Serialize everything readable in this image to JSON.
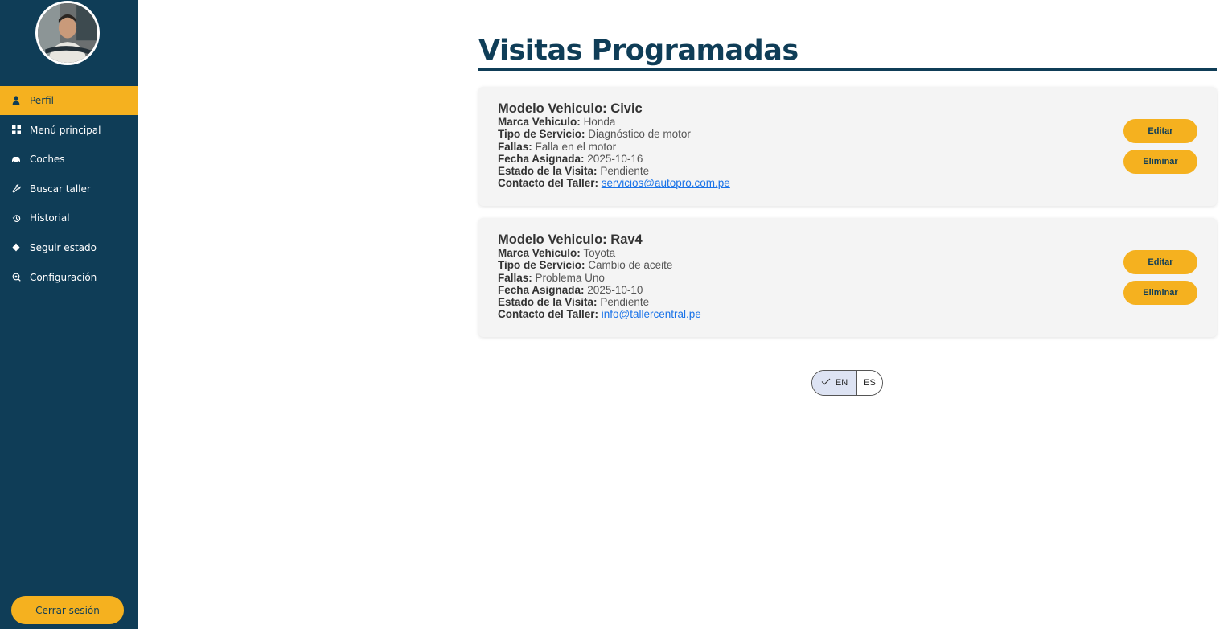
{
  "sidebar": {
    "items": [
      {
        "label": "Perfil",
        "icon": "user-icon",
        "active": true
      },
      {
        "label": "Menú principal",
        "icon": "grid-icon",
        "active": false
      },
      {
        "label": "Coches",
        "icon": "car-icon",
        "active": false
      },
      {
        "label": "Buscar taller",
        "icon": "wrench-icon",
        "active": false
      },
      {
        "label": "Historial",
        "icon": "history-icon",
        "active": false
      },
      {
        "label": "Seguir estado",
        "icon": "diamond-icon",
        "active": false
      },
      {
        "label": "Configuración",
        "icon": "settings-icon",
        "active": false
      }
    ],
    "logout_label": "Cerrar sesión"
  },
  "main": {
    "title": "Visitas Programadas",
    "labels": {
      "modelo": "Modelo Vehiculo:",
      "marca": "Marca Vehiculo:",
      "servicio": "Tipo de Servicio:",
      "fallas": "Fallas:",
      "fecha": "Fecha Asignada:",
      "estado": "Estado de la Visita:",
      "contacto": "Contacto del Taller:"
    },
    "visits": [
      {
        "modelo": "Civic",
        "marca": "Honda",
        "servicio": "Diagnóstico de motor",
        "fallas": "Falla en el motor",
        "fecha": "2025-10-16",
        "estado": "Pendiente",
        "contacto": "servicios@autopro.com.pe",
        "edit_label": "Editar",
        "delete_label": "Eliminar"
      },
      {
        "modelo": "Rav4",
        "marca": "Toyota",
        "servicio": "Cambio de aceite",
        "fallas": "Problema Uno",
        "fecha": "2025-10-10",
        "estado": "Pendiente",
        "contacto": "info@tallercentral.pe",
        "edit_label": "Editar",
        "delete_label": "Eliminar"
      }
    ]
  },
  "language": {
    "options": [
      "EN",
      "ES"
    ],
    "selected": "EN"
  },
  "colors": {
    "sidebar": "#0f3d57",
    "accent": "#f5b11f",
    "title": "#0f3d57",
    "link": "#1a73e8"
  }
}
